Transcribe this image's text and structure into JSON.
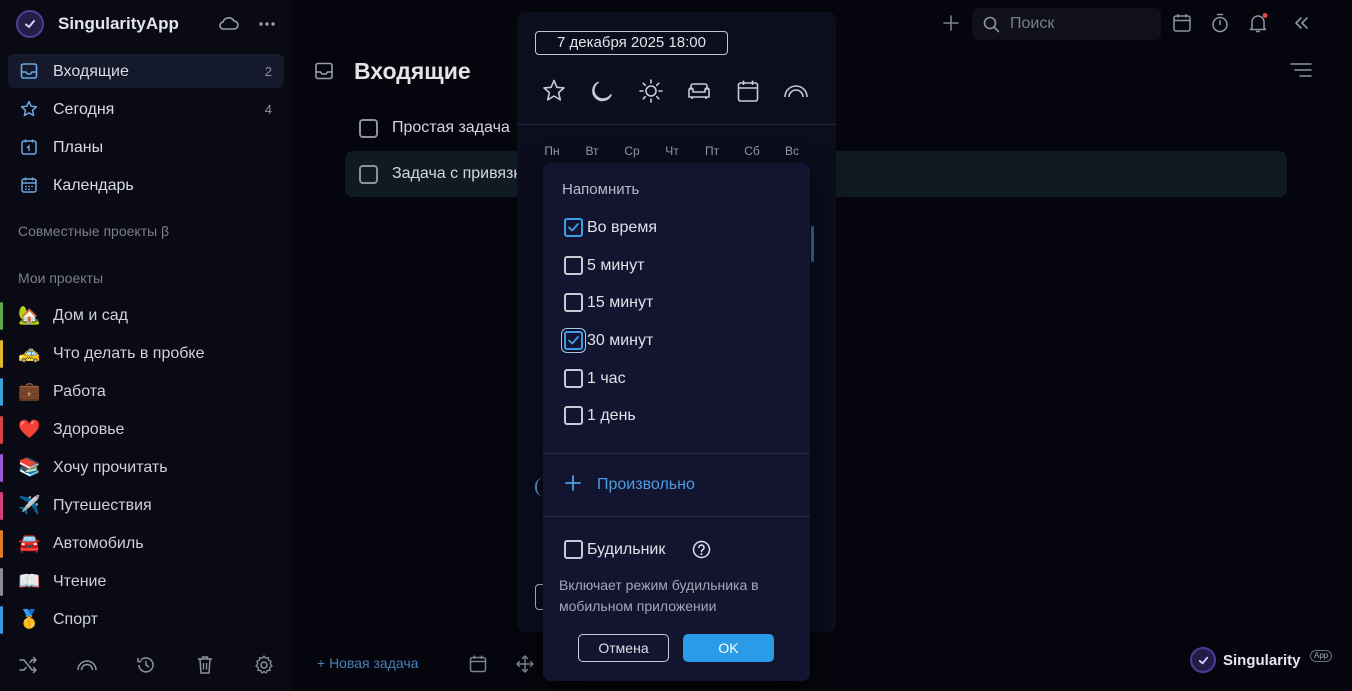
{
  "app": {
    "title": "SingularityApp"
  },
  "sidebar": {
    "nav": [
      {
        "label": "Входящие",
        "count": "2",
        "icon": "inbox-icon"
      },
      {
        "label": "Сегодня",
        "count": "4",
        "icon": "star-icon"
      },
      {
        "label": "Планы",
        "count": "",
        "icon": "plans-icon"
      },
      {
        "label": "Календарь",
        "count": "",
        "icon": "calendar-icon"
      }
    ],
    "shared_section": "Совместные проекты β",
    "my_section": "Мои проекты",
    "projects": [
      {
        "emoji": "🏡",
        "label": "Дом и сад",
        "color": "#5aa94e"
      },
      {
        "emoji": "🚕",
        "label": "Что делать в пробке",
        "color": "#e0b82e"
      },
      {
        "emoji": "💼",
        "label": "Работа",
        "color": "#3aa0d8"
      },
      {
        "emoji": "❤️",
        "label": "Здоровье",
        "color": "#d94343"
      },
      {
        "emoji": "📚",
        "label": "Хочу прочитать",
        "color": "#9b59d0"
      },
      {
        "emoji": "✈️",
        "label": "Путешествия",
        "color": "#d9417a"
      },
      {
        "emoji": "🚘",
        "label": "Автомобиль",
        "color": "#e07b2e"
      },
      {
        "emoji": "📖",
        "label": "Чтение",
        "color": "#8a8d99"
      },
      {
        "emoji": "🥇",
        "label": "Спорт",
        "color": "#3a9bd8"
      }
    ]
  },
  "topbar": {
    "search_placeholder": "Поиск"
  },
  "main": {
    "title": "Входящие",
    "tasks": [
      "Простая задача",
      "Задача с привязкой"
    ],
    "new_task": "+ Новая задача",
    "brand": "Singularity",
    "brand_badge": "App"
  },
  "date_panel": {
    "date_value": "7 декабря 2025 18:00",
    "weekdays": [
      "Пн",
      "Вт",
      "Ср",
      "Чт",
      "Пт",
      "Сб",
      "Вс"
    ],
    "quick_icons": [
      "star-icon",
      "moon-icon",
      "sun-icon",
      "sofa-icon",
      "calendar-icon",
      "rainbow-icon"
    ]
  },
  "remind": {
    "title": "Напомнить",
    "options": [
      {
        "label": "Во время",
        "checked": true
      },
      {
        "label": "5 минут",
        "checked": false
      },
      {
        "label": "15 минут",
        "checked": false
      },
      {
        "label": "30 минут",
        "checked": true
      },
      {
        "label": "1 час",
        "checked": false
      },
      {
        "label": "1 день",
        "checked": false
      }
    ],
    "custom_label": "Произвольно",
    "alarm_label": "Будильник",
    "alarm_note": "Включает режим будильника в мобильном приложении",
    "cancel": "Отмена",
    "ok": "OK"
  }
}
